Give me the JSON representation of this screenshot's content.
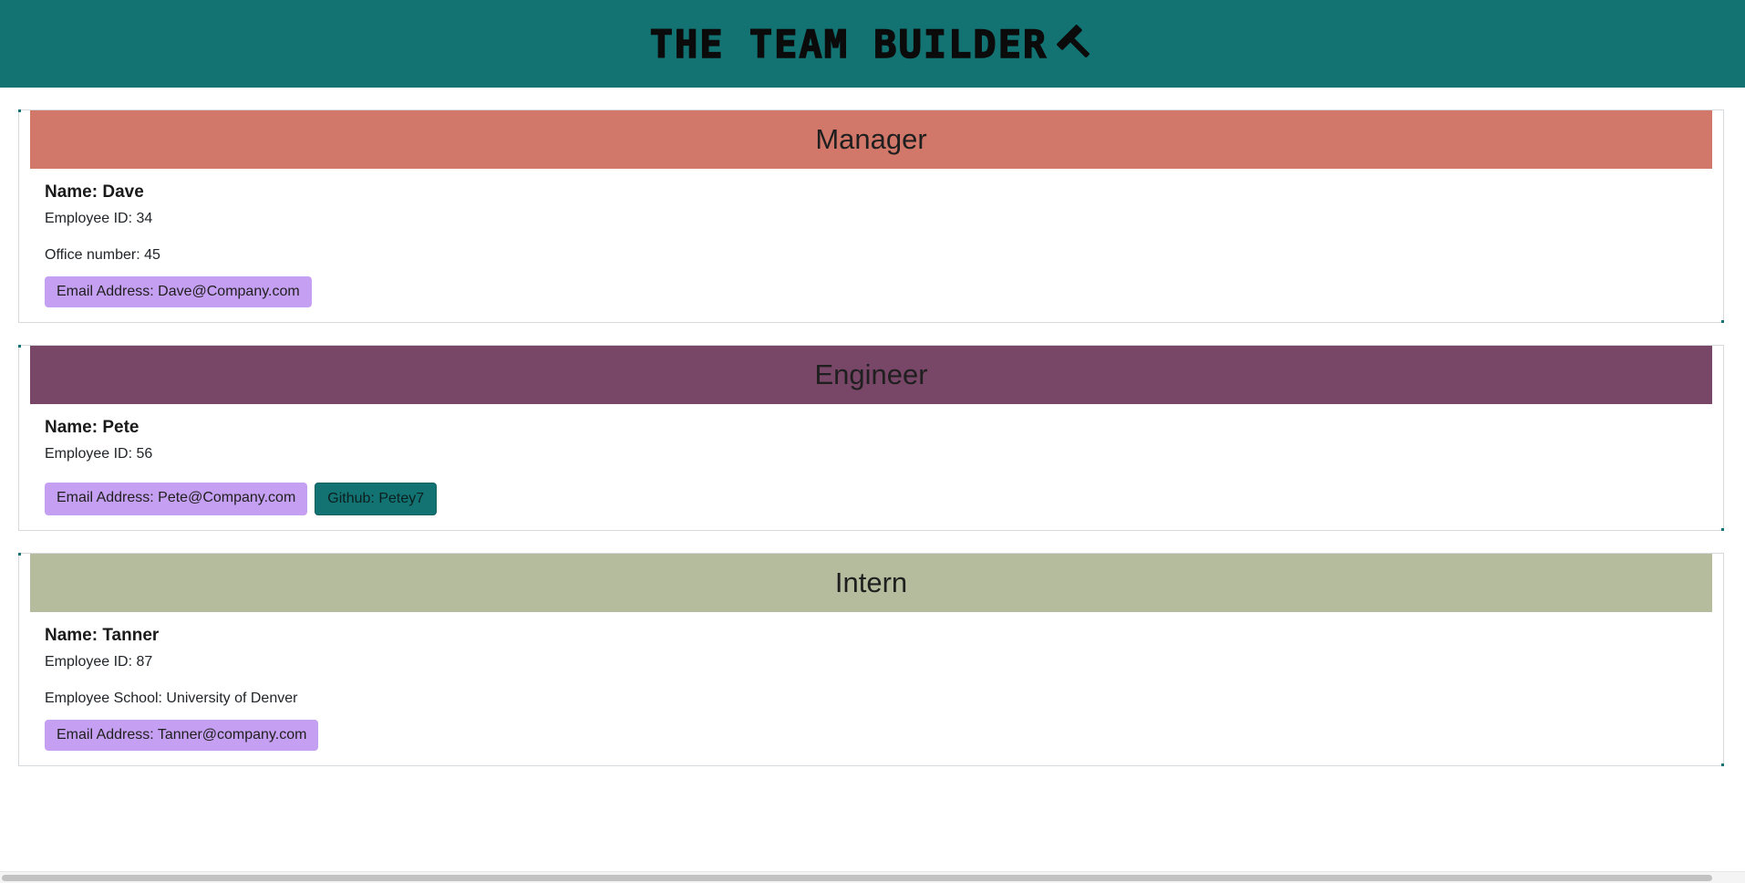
{
  "header": {
    "title": "THE TEAM BUILDER",
    "icon": "hammer-icon",
    "background": "#137373"
  },
  "colors": {
    "manager": "#d2786a",
    "engineer": "#784667",
    "intern": "#b5bb9d",
    "email_chip": "#c5a0f2",
    "github_chip": "#137373"
  },
  "cards": [
    {
      "role": "Manager",
      "name": "Name: Dave",
      "id": "Employee ID: 34",
      "extra": "Office number: 45",
      "email": "Email Address: Dave@Company.com"
    },
    {
      "role": "Engineer",
      "name": "Name: Pete",
      "id": "Employee ID: 56",
      "email": "Email Address: Pete@Company.com",
      "github": "Github: Petey7"
    },
    {
      "role": "Intern",
      "name": "Name: Tanner",
      "id": "Employee ID: 87",
      "extra": "Employee School: University of Denver",
      "email": "Email Address: Tanner@company.com"
    }
  ]
}
